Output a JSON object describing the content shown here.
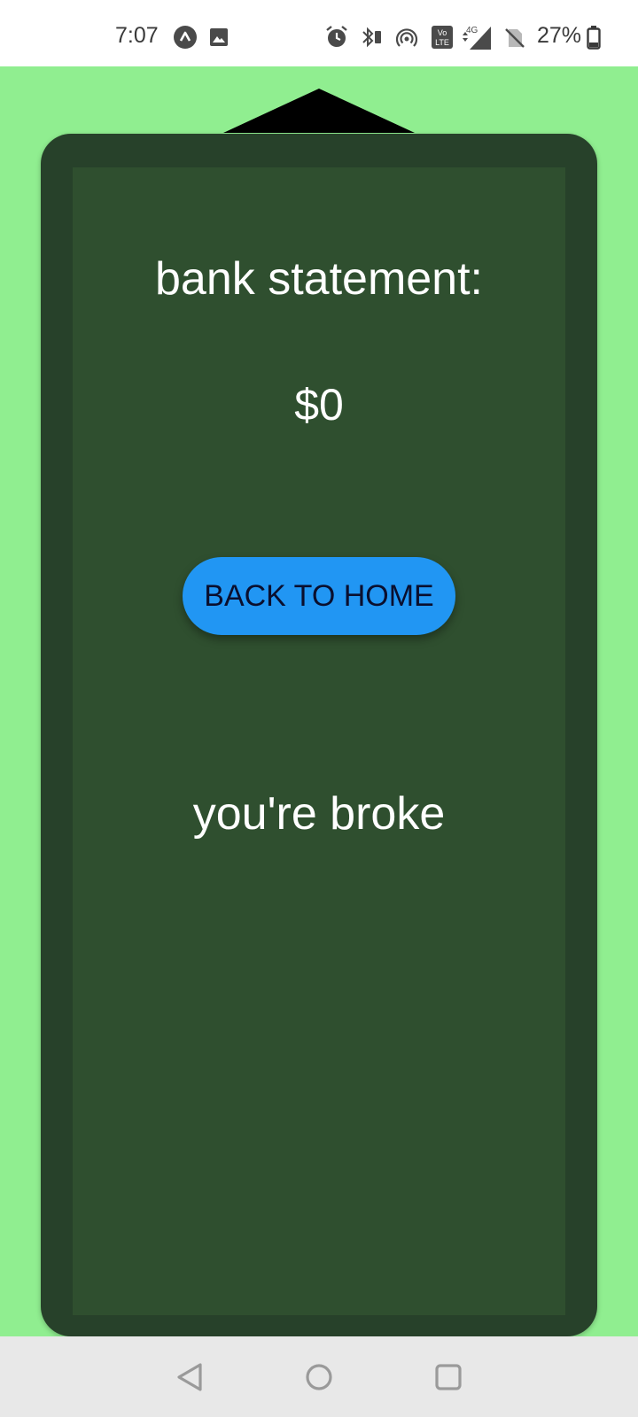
{
  "status_bar": {
    "time": "7:07",
    "battery_percent": "27%",
    "network_label": "4G",
    "volte_label": "Vo LTE",
    "icons": [
      "app-notification-icon",
      "gallery-icon",
      "alarm-icon",
      "bluetooth-icon",
      "hotspot-icon",
      "volte-icon",
      "signal-icon",
      "no-sim-icon",
      "battery-icon"
    ]
  },
  "screen": {
    "title": "bank statement:",
    "balance": "$0",
    "back_button_label": "BACK TO HOME",
    "message": "you're broke"
  },
  "colors": {
    "background": "#90EE90",
    "frame": "#27412A",
    "panel": "#2F4F2F",
    "button": "#2196F3",
    "nav_bar": "#E8E8E8"
  },
  "nav_bar": {
    "buttons": [
      "back-icon",
      "home-icon",
      "recents-icon"
    ]
  }
}
